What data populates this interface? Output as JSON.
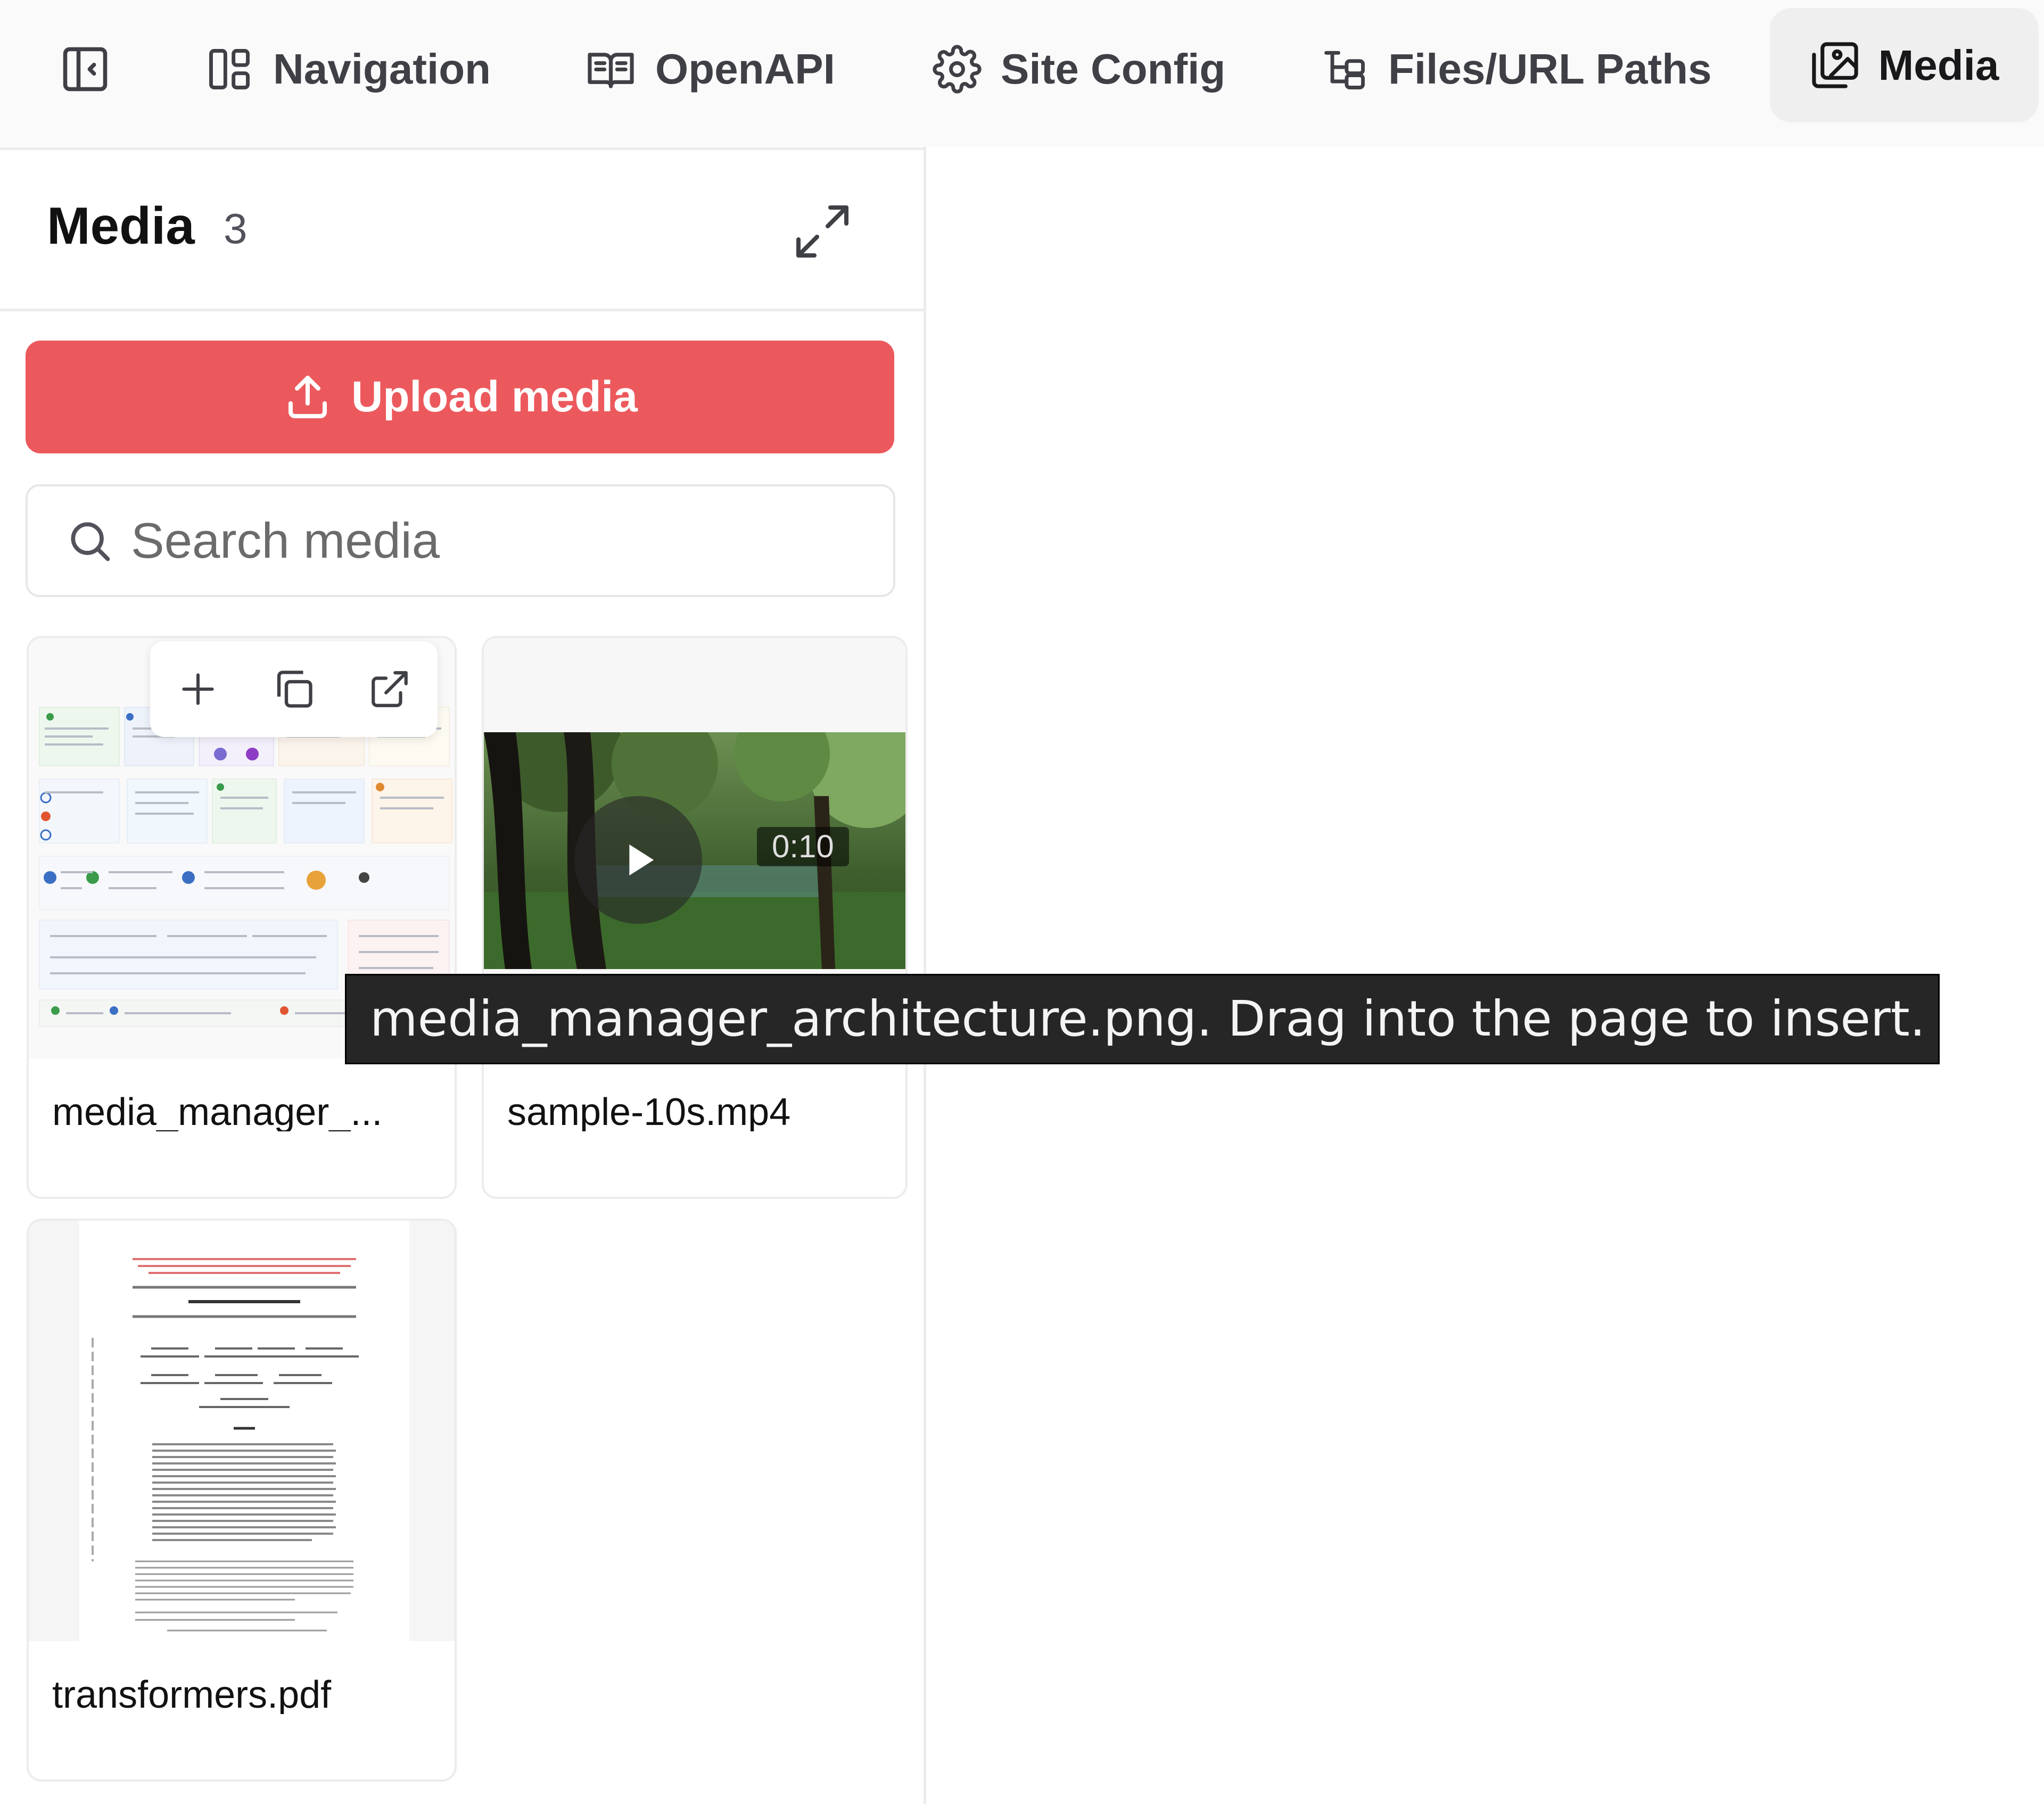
{
  "toolbar": {
    "tabs": [
      {
        "label": "Navigation",
        "icon": "layout-icon"
      },
      {
        "label": "OpenAPI",
        "icon": "book-open-icon"
      },
      {
        "label": "Site Config",
        "icon": "gear-icon"
      },
      {
        "label": "Files/URL Paths",
        "icon": "file-tree-icon"
      },
      {
        "label": "Media",
        "icon": "images-icon",
        "active": true
      }
    ]
  },
  "panel": {
    "title": "Media",
    "count": "3",
    "upload_label": "Upload media",
    "search_placeholder": "Search media"
  },
  "media": {
    "items": [
      {
        "name": "media_manager_...",
        "type": "image"
      },
      {
        "name": "sample-10s.mp4",
        "type": "video",
        "duration": "0:10"
      },
      {
        "name": "transformers.pdf",
        "type": "pdf"
      }
    ]
  },
  "tooltip": {
    "text": "media_manager_architecture.png. Drag into the page to insert."
  },
  "colors": {
    "accent": "#ec595d",
    "tooltip_bg": "#262626",
    "active_tab_bg": "#efefef"
  }
}
